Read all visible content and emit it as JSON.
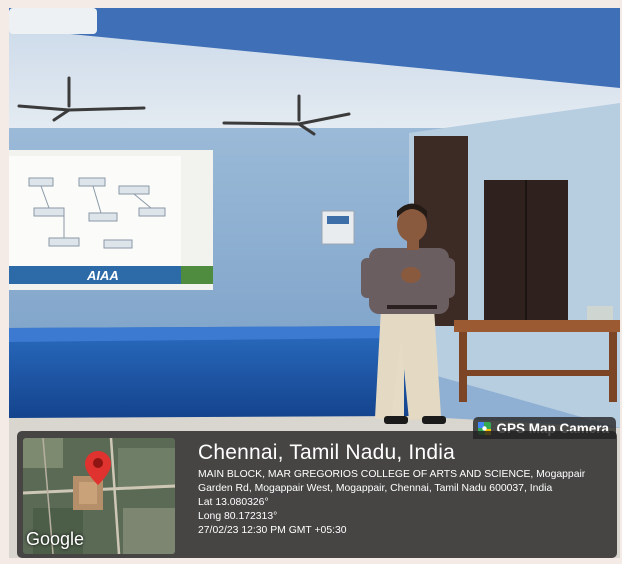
{
  "gps_badge": {
    "label": "GPS Map Camera",
    "icon": "map-icon"
  },
  "location": {
    "title": "Chennai, Tamil Nadu, India",
    "address": "MAIN BLOCK, MAR GREGORIOS COLLEGE OF ARTS AND SCIENCE, Mogappair Garden Rd, Mogappair West, Mogappair, Chennai, Tamil Nadu 600037, India",
    "lat": "Lat 13.080326°",
    "long": "Long 80.172313°",
    "timestamp": "27/02/23 12:30 PM GMT +05:30"
  },
  "map": {
    "brand": "Google",
    "pin_color": "#e0322e"
  },
  "projector": {
    "logo": "AIAA"
  },
  "colors": {
    "wall": "#8fb0d2",
    "stage": "#1f5aa8",
    "overlay": "#202020"
  }
}
